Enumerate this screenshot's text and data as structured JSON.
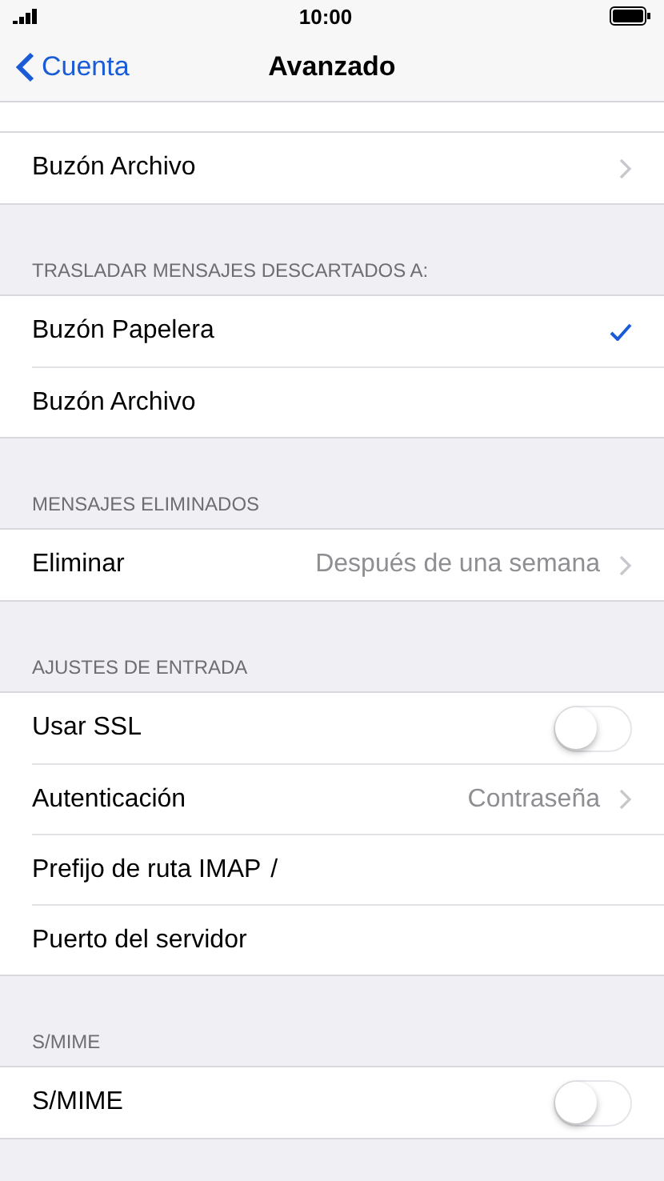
{
  "status_bar": {
    "time": "10:00"
  },
  "nav": {
    "back": "Cuenta",
    "title": "Avanzado"
  },
  "sections": [
    {
      "rows": [
        {
          "kind": "chevron",
          "label": "Buzón Archivo"
        }
      ]
    },
    {
      "header": "TRASLADAR MENSAJES DESCARTADOS A:",
      "rows": [
        {
          "kind": "check",
          "label": "Buzón Papelera",
          "checked": true
        },
        {
          "kind": "check",
          "label": "Buzón Archivo",
          "checked": false
        }
      ]
    },
    {
      "header": "MENSAJES ELIMINADOS",
      "rows": [
        {
          "kind": "chevron",
          "label": "Eliminar",
          "value": "Después de una semana"
        }
      ]
    },
    {
      "header": "AJUSTES DE ENTRADA",
      "rows": [
        {
          "kind": "toggle",
          "label": "Usar SSL",
          "on": false
        },
        {
          "kind": "chevron",
          "label": "Autenticación",
          "value": "Contraseña"
        },
        {
          "kind": "field",
          "label": "Prefijo de ruta IMAP",
          "value": "/"
        },
        {
          "kind": "field",
          "label": "Puerto del servidor"
        }
      ]
    },
    {
      "header": "S/MIME",
      "rows": [
        {
          "kind": "toggle",
          "label": "S/MIME",
          "on": false
        }
      ]
    }
  ]
}
